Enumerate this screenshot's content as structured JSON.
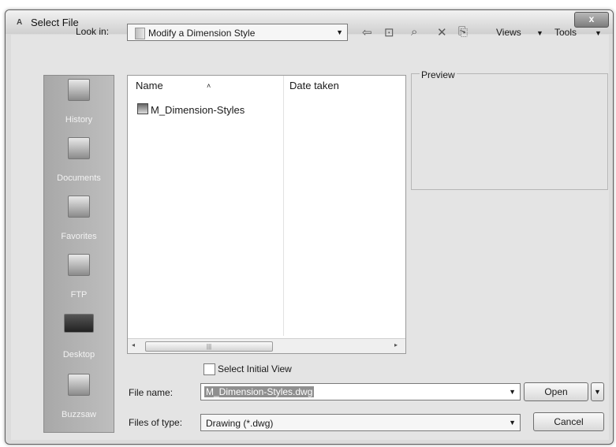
{
  "window": {
    "title": "Select File",
    "app_icon_label": "A",
    "close_glyph": "x"
  },
  "toolbar": {
    "lookin_label": "Look in:",
    "lookin_value": "Modify a Dimension Style",
    "dropdown_glyph": "▼",
    "icons": [
      "back-arrow-icon",
      "up-folder-icon",
      "search-web-icon",
      "delete-icon",
      "new-folder-icon"
    ],
    "views_label": "Views",
    "tools_label": "Tools"
  },
  "places": [
    {
      "label": "History",
      "icon": "history-icon"
    },
    {
      "label": "Documents",
      "icon": "documents-icon"
    },
    {
      "label": "Favorites",
      "icon": "favorites-icon"
    },
    {
      "label": "FTP",
      "icon": "ftp-icon"
    },
    {
      "label": "Desktop",
      "icon": "desktop-icon"
    },
    {
      "label": "Buzzsaw",
      "icon": "buzzsaw-icon"
    }
  ],
  "filelist": {
    "columns": [
      "Name",
      "Date taken"
    ],
    "files": [
      {
        "name": "M_Dimension-Styles"
      }
    ]
  },
  "preview": {
    "label": "Preview"
  },
  "options": {
    "select_initial_view_label": "Select Initial View",
    "select_initial_view_checked": false
  },
  "fields": {
    "filename_label": "File name:",
    "filename_value": "M_Dimension-Styles.dwg",
    "filetype_label": "Files of type:",
    "filetype_value": "Drawing (*.dwg)"
  },
  "buttons": {
    "open": "Open",
    "cancel": "Cancel"
  }
}
